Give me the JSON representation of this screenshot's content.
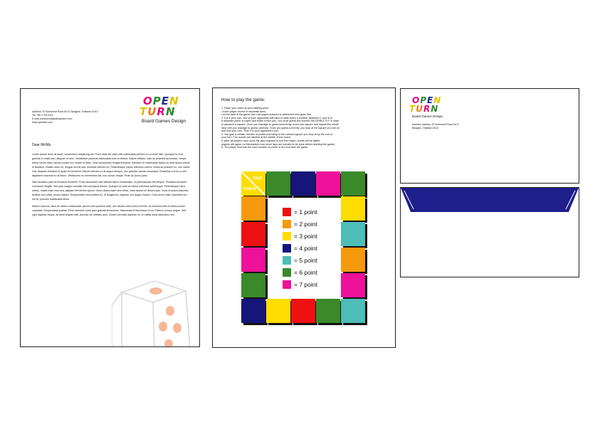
{
  "brand": {
    "logo_line1": [
      "O",
      "P",
      "E",
      "N"
    ],
    "logo_line2": [
      "T",
      "U",
      "R",
      "N"
    ],
    "logo_colors": [
      "#e5007e",
      "#2a8a2a",
      "#1e2a8a",
      "#e0c400"
    ],
    "tagline": "Board Games Design"
  },
  "letterhead": {
    "address_lines": [
      "Address: 32 Sukhumvit Road Soi 8, Bangkok, Thailand 10110",
      "Tel: +66 3 704 0112",
      "E-mail: jnlvonmmalad@opentum.com",
      "www.opentum.com"
    ],
    "salutation": "Dear Mr/Ms.",
    "paragraphs": [
      "Lorem ipsum dolor sit amet, consectetur adipiscing elit. Proin vitae elit vitae velit malesuada pretium eu ut amet nibh. Quisque ex erat, gravida in mollis sed, aliquam et sem. Vestibulum placerat malesuada eros et finibus. Mauris efficitur, odio ac pharetra accumsan, neque tellus rutrum diam, lacinia ornare orci neque ut diam. Cras consectetur feugiat tincidunt. Interdum et malesuada fames ac ante ipsum primis in faucibus. Nullam dolor mi, feugiat vel est sed, molestie ultricies ex. Pellentesque varius interdum viverra. Morbi ac posuere ex, non varius erat. Aliquam tincidunt et quam at hendrerit. Mauris ultricies ex at augue semper, nec gravida mauris consequat. Phasellus a eros ut velit dignissim euismod eu at libero. Vestibulum eu elementum elit, non cursus neque. Proin ac purus justo.",
      "Nam faucibus justo at tincidunt hendrerit. Proin accumsan odio ultrices libero consectetur, ut pellentesque elit tempus. Praesent tincidunt commodo fringilla. Sed quis magna convallis elit consequat dictum. Quisque et nulla ac metus maximus scelerisque. Pellentesque risus metus, mattis vitae eros sed, aliquam fermentum ipsum. Nunc ullamcorper sem tellus, vitae lacinia mi dictum quis. Nunc et ipsum placerat, facilisis arcu vitae, auctor sapien. Suspendisse sed porttitor ex, id feugiat leo. Aliquam non augue mauris. Cras lorem nulla, imperdiet nec est at, posuere malesuada tellus.",
      "Mauris rhoncus, risus ac dictum malesuada, ipsum urna posuere ante, nec ultrices ante enim id lorem. Ut euismod velit et metus auctor vulputate. Suspendisse potenti. Proin interdum dolor quis gravida fermentum. Maecenas id fermentum eros. Etiam in cursus augue. Sed eget dapibus neque, sit amet aliquet velit. Aenean vel ultricies arcu. Donec convallis dapibus mi, et mattis nulla bibendum non."
    ]
  },
  "rules": {
    "title": "How to play the game:",
    "items": [
      "1. Place your token at your starting point",
      "• Each player moves in separate turns",
      "• At the start of the game use rock-paper-scissors to determine who goes first",
      "2. If it is your turn, one of your opponents will have to write down a number (between 1 and 4) in",
      "a separate piece of paper and hides it from you. You must guess the number INCORRECTLY in order",
      "to advance a square. Once you manage to guess incorrectly, move one square and repeat this whole",
      "step until you manage to guess correctly. Once you guess correctly, you stop at the square you are on",
      "and end your turn. Then it is your opponent's turn.",
      "3. You gain a certain number of points according to the colored square you stop at by the end of",
      "your turn. The scores are labeled at the middle of the board",
      "4. After all players have done the laps required to end the match, points will be tallied",
      "players will agree on themselves how much laps are needed to be done before starting the game)",
      "5. The player that has the most number of points in the end wins the game."
    ],
    "start_label": "Start",
    "finish_label": "Finish",
    "legend": [
      {
        "color": "#ee1111",
        "label": "= 1 point"
      },
      {
        "color": "#f59a0c",
        "label": "= 2 point"
      },
      {
        "color": "#ffdd00",
        "label": "= 3 point"
      },
      {
        "color": "#16157a",
        "label": "= 4 point"
      },
      {
        "color": "#4dbdb8",
        "label": "= 5 point"
      },
      {
        "color": "#3a8a2a",
        "label": "= 6 point"
      },
      {
        "color": "#ee1199",
        "label": "= 7 point"
      }
    ]
  },
  "envelope": {
    "address_lines": [
      "Address: Address: 32 Sukhumvit Road Soi 8,",
      "Bangkok, Thailand 10110"
    ],
    "flap_color": "#1e1f8c"
  }
}
